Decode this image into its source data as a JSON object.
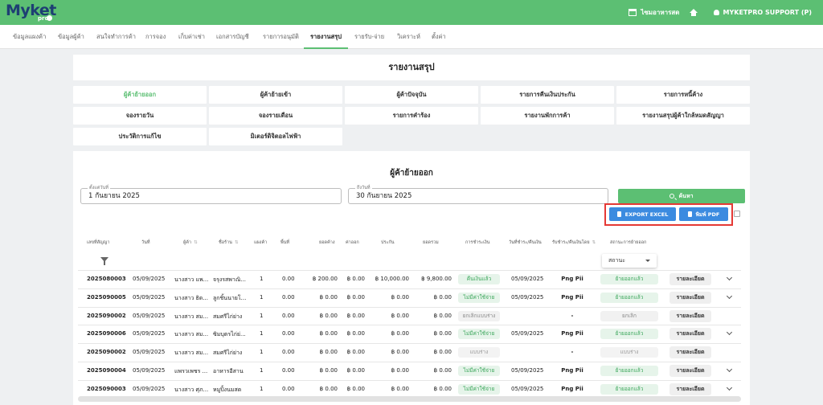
{
  "app": {
    "logo": "Myket",
    "logo_sub": "pro",
    "store_label": "ไซมอาหารสด",
    "user_label": "MYKETPRO SUPPORT (P)"
  },
  "nav": {
    "items": [
      "ข้อมูลแผงค้า",
      "ข้อมูลผู้ค้า",
      "สนใจทำการค้า",
      "การจอง",
      "เก็บค่าเช่า",
      "เอกสารบัญชี",
      "รายการอนุมัติ",
      "รายงานสรุป",
      "รายรับ-จ่าย",
      "วิเคราะห์",
      "ตั้งค่า"
    ],
    "active_index": 7
  },
  "page_title": "รายงานสรุป",
  "report_buttons": [
    {
      "label": "ผู้ค้าย้ายออก",
      "active": true
    },
    {
      "label": "ผู้ค้าย้ายเข้า",
      "active": false
    },
    {
      "label": "ผู้ค้าปัจจุบัน",
      "active": false
    },
    {
      "label": "รายการคืนเงินประกัน",
      "active": false
    },
    {
      "label": "รายการหนี้ค้าง",
      "active": false
    },
    {
      "label": "จองรายวัน",
      "active": false
    },
    {
      "label": "จองรายเดือน",
      "active": false
    },
    {
      "label": "รายการคำร้อง",
      "active": false
    },
    {
      "label": "รายงานพักการค้า",
      "active": false
    },
    {
      "label": "รายงานสรุปผู้ค้าใกล้หมดสัญญา",
      "active": false
    },
    {
      "label": "ประวัติการแก้ไข",
      "active": false
    },
    {
      "label": "มิเตอร์ดิจิตอลไฟฟ้า",
      "active": false
    }
  ],
  "section_title": "ผู้ค้าย้ายออก",
  "filters": {
    "start_label": "ตั้งแต่วันที่",
    "start_value": "1 กันยายน 2025",
    "end_label": "ถึงวันที่",
    "end_value": "30 กันยายน 2025",
    "search_label": "ค้นหา",
    "export_excel_label": "EXPORT EXCEL",
    "print_pdf_label": "พิมพ์ PDF",
    "status_placeholder": "สถานะ"
  },
  "table": {
    "columns": [
      "เลขที่สัญญา",
      "วันที่",
      "ผู้ค้า",
      "ชื่อร้าน",
      "แผงค้า",
      "พื้นที่",
      "ยอดค้าง",
      "ค่าออก",
      "ประกัน",
      "ยอดรวม",
      "การชำระเงิน",
      "วันที่ชำระ/คืนเงิน",
      "รับชำระ/คืนเงินโดย",
      "สถานะการย้ายออก"
    ],
    "rows": [
      {
        "contract": "2025080003",
        "date": "05/09/2025",
        "name": "นางสาว แพ...",
        "shop": "จรุงรสพาณิ...",
        "stall": "1",
        "area": "0.00",
        "due": "฿ 200.00",
        "fee": "฿ 0.00",
        "deposit": "฿ 10,000.00",
        "total": "฿ 9,800.00",
        "payment": "คืนเงินแล้ว",
        "payment_style": "green",
        "paid_date": "05/09/2025",
        "by": "Png Pii",
        "status": "ย้ายออกแล้ว",
        "status_style": "green",
        "detail": "รายละเอียด",
        "expand": true
      },
      {
        "contract": "2025090005",
        "date": "05/09/2025",
        "name": "นางสาว ธิด...",
        "shop": "ลูกชิ้นนายโ...",
        "stall": "1",
        "area": "0.00",
        "due": "฿ 0.00",
        "fee": "฿ 0.00",
        "deposit": "฿ 0.00",
        "total": "฿ 0.00",
        "payment": "ไม่มีค่าใช้จ่าย",
        "payment_style": "green",
        "paid_date": "05/09/2025",
        "by": "Png Pii",
        "status": "ย้ายออกแล้ว",
        "status_style": "green",
        "detail": "รายละเอียด",
        "expand": true
      },
      {
        "contract": "2025090002",
        "date": "05/09/2025",
        "name": "นางสาว สม...",
        "shop": "สมศรีไก่ย่าง",
        "stall": "1",
        "area": "0.00",
        "due": "฿ 0.00",
        "fee": "฿ 0.00",
        "deposit": "฿ 0.00",
        "total": "฿ 0.00",
        "payment": "ยกเลิกแบบร่าง",
        "payment_style": "grey",
        "paid_date": "",
        "by": "-",
        "status": "ยกเลิก",
        "status_style": "grey",
        "detail": "รายละเอียด",
        "expand": false
      },
      {
        "contract": "2025090006",
        "date": "05/09/2025",
        "name": "นางสาว สม...",
        "shop": "ซิมบุตรไก่ย่...",
        "stall": "1",
        "area": "0.00",
        "due": "฿ 0.00",
        "fee": "฿ 0.00",
        "deposit": "฿ 0.00",
        "total": "฿ 0.00",
        "payment": "ไม่มีค่าใช้จ่าย",
        "payment_style": "green",
        "paid_date": "05/09/2025",
        "by": "Png Pii",
        "status": "ย้ายออกแล้ว",
        "status_style": "green",
        "detail": "รายละเอียด",
        "expand": true
      },
      {
        "contract": "2025090002",
        "date": "05/09/2025",
        "name": "นางสาว สม...",
        "shop": "สมศรีไก่ย่าง",
        "stall": "1",
        "area": "0.00",
        "due": "฿ 0.00",
        "fee": "฿ 0.00",
        "deposit": "฿ 0.00",
        "total": "฿ 0.00",
        "payment": "แบบร่าง",
        "payment_style": "plain",
        "paid_date": "",
        "by": "-",
        "status": "แบบร่าง",
        "status_style": "plain",
        "detail": "รายละเอียด",
        "expand": false
      },
      {
        "contract": "2025090004",
        "date": "05/09/2025",
        "name": "แพรวเพชร ...",
        "shop": "อาหารอีสาน",
        "stall": "1",
        "area": "0.00",
        "due": "฿ 0.00",
        "fee": "฿ 0.00",
        "deposit": "฿ 0.00",
        "total": "฿ 0.00",
        "payment": "ไม่มีค่าใช้จ่าย",
        "payment_style": "green",
        "paid_date": "05/09/2025",
        "by": "Png Pii",
        "status": "ย้ายออกแล้ว",
        "status_style": "green",
        "detail": "รายละเอียด",
        "expand": true
      },
      {
        "contract": "2025090003",
        "date": "05/09/2025",
        "name": "นางสาว ศุภ...",
        "shop": "หมูปิ้งนมสด",
        "stall": "1",
        "area": "0.00",
        "due": "฿ 0.00",
        "fee": "฿ 0.00",
        "deposit": "฿ 0.00",
        "total": "฿ 0.00",
        "payment": "ไม่มีค่าใช้จ่าย",
        "payment_style": "green",
        "paid_date": "05/09/2025",
        "by": "Png Pii",
        "status": "ย้ายออกแล้ว",
        "status_style": "green",
        "detail": "รายละเอียด",
        "expand": true
      }
    ]
  }
}
